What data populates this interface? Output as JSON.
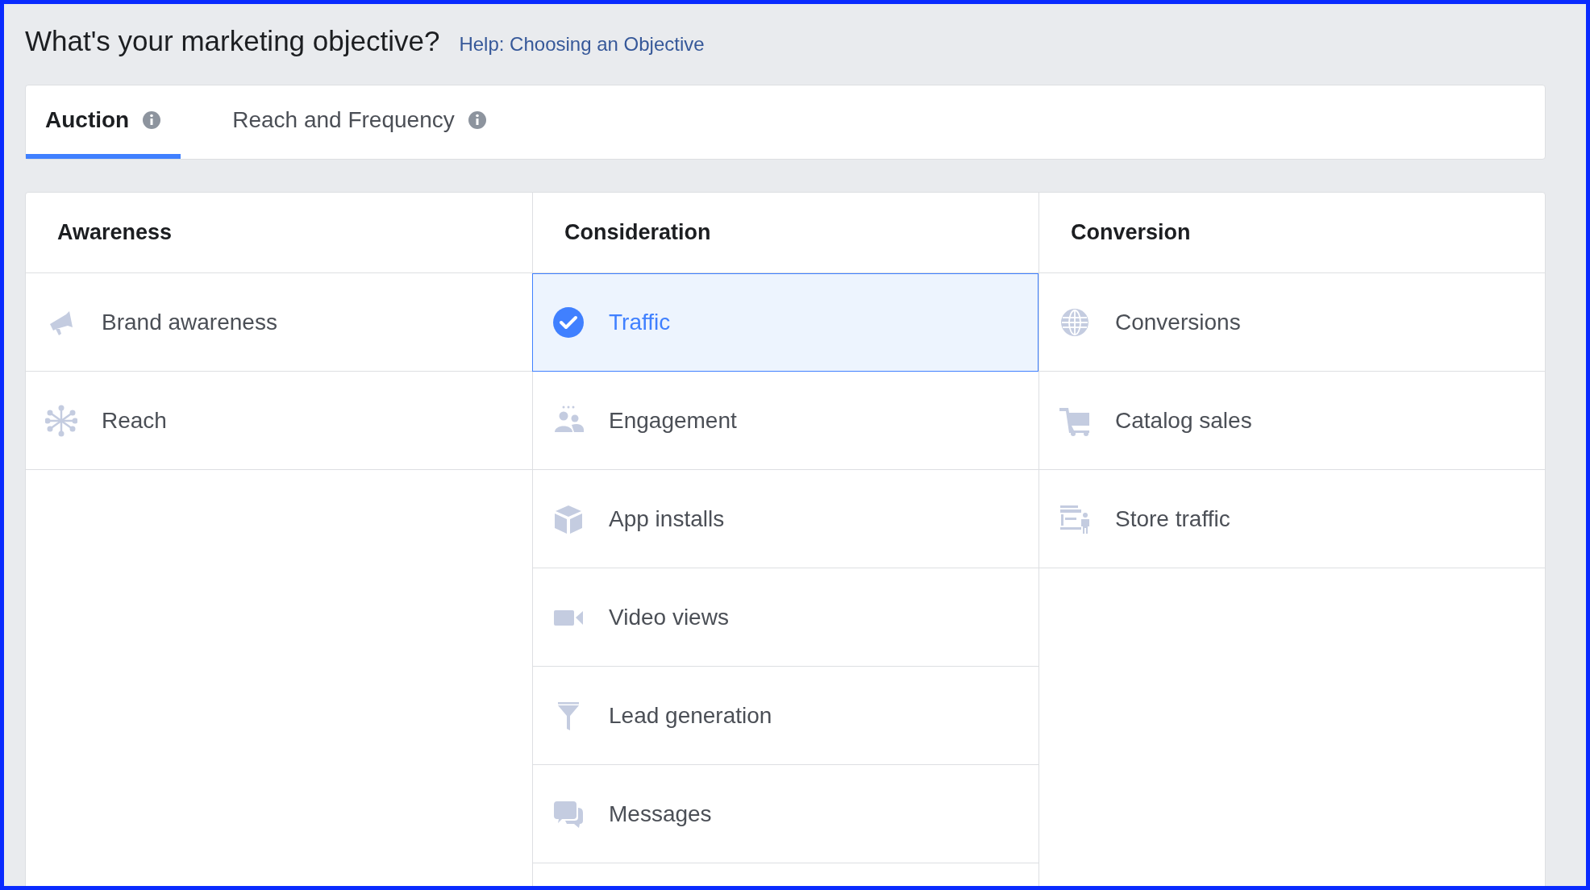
{
  "heading": {
    "title": "What's your marketing objective?",
    "help_link": "Help: Choosing an Objective"
  },
  "tabs": [
    {
      "label": "Auction",
      "selected": true
    },
    {
      "label": "Reach and Frequency",
      "selected": false
    }
  ],
  "columns": [
    {
      "title": "Awareness",
      "items": [
        {
          "label": "Brand awareness",
          "kind": "megaphone",
          "selected": false
        },
        {
          "label": "Reach",
          "kind": "network",
          "selected": false
        }
      ]
    },
    {
      "title": "Consideration",
      "items": [
        {
          "label": "Traffic",
          "selected": true
        },
        {
          "label": "Engagement",
          "kind": "people",
          "selected": false
        },
        {
          "label": "App installs",
          "kind": "cube",
          "selected": false
        },
        {
          "label": "Video views",
          "kind": "video",
          "selected": false
        },
        {
          "label": "Lead generation",
          "kind": "funnel",
          "selected": false
        },
        {
          "label": "Messages",
          "kind": "chat",
          "selected": false
        }
      ]
    },
    {
      "title": "Conversion",
      "items": [
        {
          "label": "Conversions",
          "kind": "globe",
          "selected": false
        },
        {
          "label": "Catalog sales",
          "kind": "cart",
          "selected": false
        },
        {
          "label": "Store traffic",
          "kind": "store",
          "selected": false
        }
      ]
    }
  ]
}
